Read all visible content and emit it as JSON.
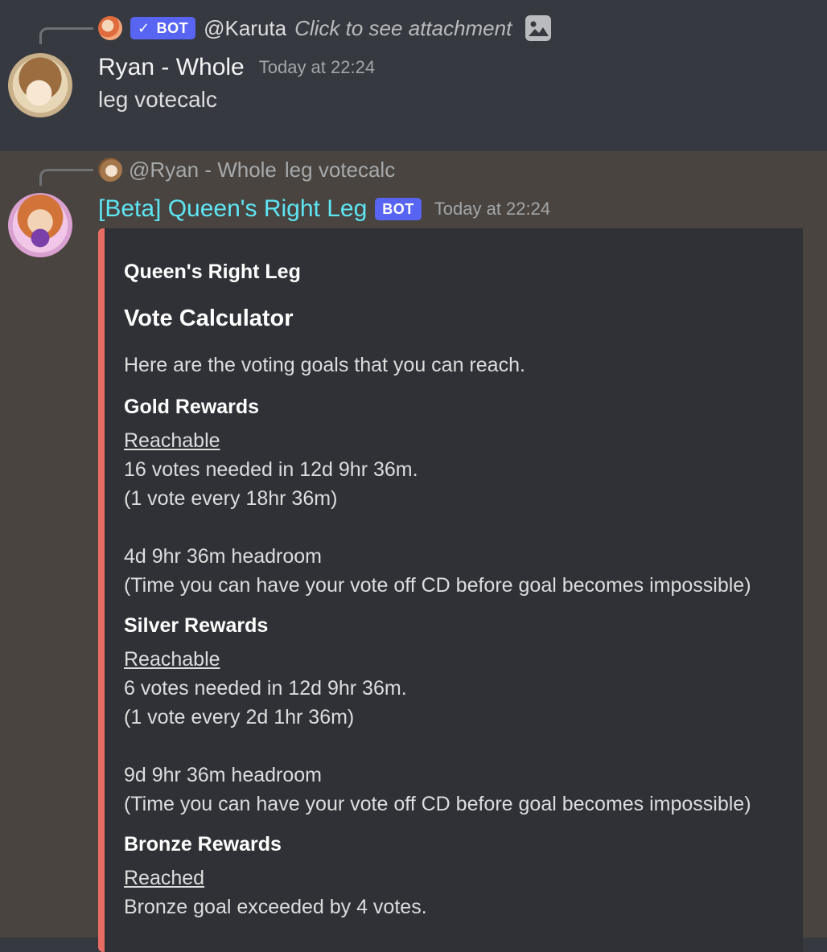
{
  "message1": {
    "reply": {
      "bot_badge": "BOT",
      "mention": "@Karuta",
      "text": "Click to see attachment"
    },
    "author": "Ryan - Whole",
    "timestamp": "Today at 22:24",
    "content": "leg votecalc"
  },
  "message2": {
    "reply": {
      "mention": "@Ryan - Whole",
      "text": "leg votecalc"
    },
    "author": "[Beta] Queen's Right Leg",
    "bot_badge": "BOT",
    "timestamp": "Today at 22:24",
    "author_color": "#5ee6f5",
    "embed": {
      "accent_color": "#e76d64",
      "author": "Queen's Right Leg",
      "title": "Vote Calculator",
      "description": "Here are the voting goals that you can reach.",
      "fields": [
        {
          "name": "Gold Rewards",
          "status": "Reachable",
          "line1": "16 votes needed in 12d 9hr 36m.",
          "line2": "(1 vote every 18hr 36m)",
          "line3": "4d 9hr 36m headroom",
          "line4": "(Time you can have your vote off CD before goal becomes impossible)"
        },
        {
          "name": "Silver Rewards",
          "status": "Reachable",
          "line1": "6 votes needed in 12d 9hr 36m.",
          "line2": "(1 vote every 2d 1hr 36m)",
          "line3": "9d 9hr 36m headroom",
          "line4": "(Time you can have your vote off CD before goal becomes impossible)"
        },
        {
          "name": "Bronze Rewards",
          "status": "Reached",
          "line1": "Bronze goal exceeded by 4 votes."
        }
      ]
    }
  }
}
